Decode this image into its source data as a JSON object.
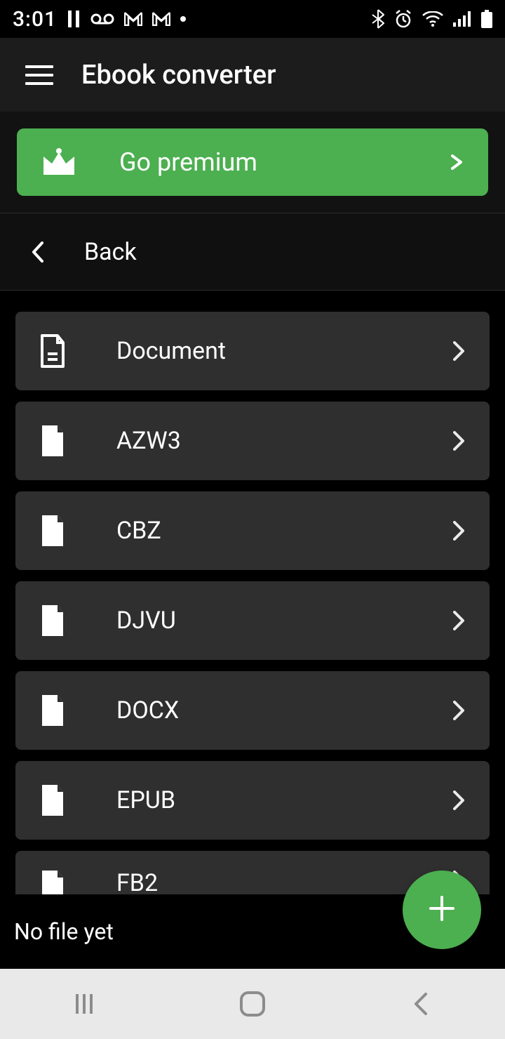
{
  "status": {
    "time": "3:01"
  },
  "header": {
    "title": "Ebook converter"
  },
  "premium": {
    "label": "Go premium"
  },
  "back": {
    "label": "Back"
  },
  "formats": [
    {
      "label": "Document",
      "icon": "document"
    },
    {
      "label": "AZW3",
      "icon": "file"
    },
    {
      "label": "CBZ",
      "icon": "file"
    },
    {
      "label": "DJVU",
      "icon": "file"
    },
    {
      "label": "DOCX",
      "icon": "file"
    },
    {
      "label": "EPUB",
      "icon": "file"
    },
    {
      "label": "FB2",
      "icon": "file"
    }
  ],
  "bottom": {
    "no_file": "No file yet"
  }
}
